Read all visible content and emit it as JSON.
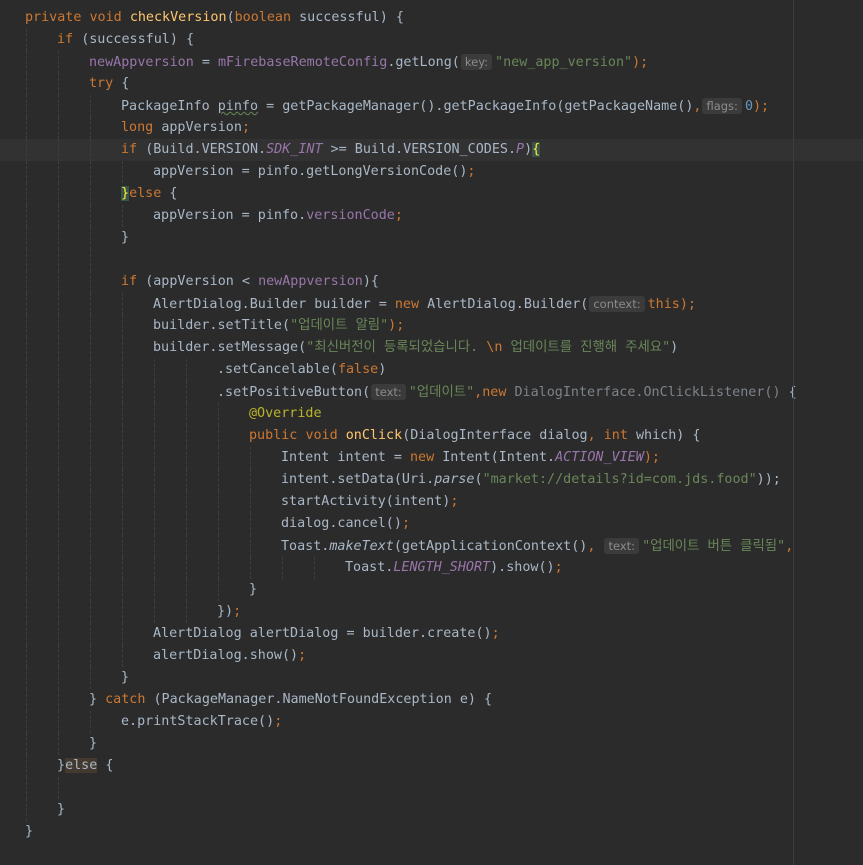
{
  "editor": {
    "lines": [
      {
        "indent": 0,
        "guides": [],
        "tokens": [
          {
            "t": "private ",
            "c": "keyword"
          },
          {
            "t": "void ",
            "c": "keyword"
          },
          {
            "t": "checkVersion",
            "c": "method"
          },
          {
            "t": "(",
            "c": "default"
          },
          {
            "t": "boolean ",
            "c": "keyword"
          },
          {
            "t": "successful) {",
            "c": "default"
          }
        ]
      },
      {
        "indent": 1,
        "guides": [
          0
        ],
        "tokens": [
          {
            "t": "if ",
            "c": "keyword"
          },
          {
            "t": "(successful) {",
            "c": "default"
          }
        ]
      },
      {
        "indent": 2,
        "guides": [
          0,
          1
        ],
        "tokens": [
          {
            "t": "newAppversion",
            "c": "field"
          },
          {
            "t": " = ",
            "c": "default"
          },
          {
            "t": "mFirebaseRemoteConfig",
            "c": "field"
          },
          {
            "t": ".getLong(",
            "c": "default"
          },
          {
            "t": "key:",
            "c": "hint"
          },
          {
            "t": "\"new_app_version\"",
            "c": "string"
          },
          {
            "t": ");",
            "c": "keyword"
          }
        ]
      },
      {
        "indent": 2,
        "guides": [
          0,
          1
        ],
        "tokens": [
          {
            "t": "try ",
            "c": "keyword"
          },
          {
            "t": "{",
            "c": "default"
          }
        ]
      },
      {
        "indent": 3,
        "guides": [
          0,
          1,
          2
        ],
        "tokens": [
          {
            "t": "PackageInfo ",
            "c": "default"
          },
          {
            "t": "pinfo",
            "c": "underline"
          },
          {
            "t": " = getPackageManager().getPackageInfo(getPackageName()",
            "c": "default"
          },
          {
            "t": ",",
            "c": "keyword"
          },
          {
            "t": "flags:",
            "c": "hint"
          },
          {
            "t": "0",
            "c": "number"
          },
          {
            "t": ");",
            "c": "keyword"
          }
        ]
      },
      {
        "indent": 3,
        "guides": [
          0,
          1,
          2
        ],
        "tokens": [
          {
            "t": "long ",
            "c": "keyword"
          },
          {
            "t": "appVersion",
            "c": "default"
          },
          {
            "t": ";",
            "c": "keyword"
          }
        ]
      },
      {
        "indent": 3,
        "guides": [
          0,
          1,
          2
        ],
        "current": true,
        "tokens": [
          {
            "t": "if ",
            "c": "keyword"
          },
          {
            "t": "(Build.VERSION.",
            "c": "default"
          },
          {
            "t": "SDK_INT",
            "c": "field-italic"
          },
          {
            "t": " >= Build.VERSION_CODES.",
            "c": "default"
          },
          {
            "t": "P",
            "c": "field-italic"
          },
          {
            "t": ")",
            "c": "default"
          },
          {
            "t": "{",
            "c": "brace-match"
          }
        ]
      },
      {
        "indent": 4,
        "guides": [
          0,
          1,
          2,
          3
        ],
        "tokens": [
          {
            "t": "appVersion = pinfo.getLongVersionCode()",
            "c": "default"
          },
          {
            "t": ";",
            "c": "keyword"
          }
        ]
      },
      {
        "indent": 3,
        "guides": [
          0,
          1,
          2
        ],
        "tokens": [
          {
            "t": "}",
            "c": "brace-match"
          },
          {
            "t": "else ",
            "c": "keyword"
          },
          {
            "t": "{",
            "c": "default"
          }
        ]
      },
      {
        "indent": 4,
        "guides": [
          0,
          1,
          2,
          3
        ],
        "tokens": [
          {
            "t": "appVersion = pinfo.",
            "c": "default"
          },
          {
            "t": "versionCode",
            "c": "field"
          },
          {
            "t": ";",
            "c": "keyword"
          }
        ]
      },
      {
        "indent": 3,
        "guides": [
          0,
          1,
          2
        ],
        "tokens": [
          {
            "t": "}",
            "c": "default"
          }
        ]
      },
      {
        "indent": 0,
        "guides": [
          0,
          1,
          2
        ],
        "tokens": []
      },
      {
        "indent": 3,
        "guides": [
          0,
          1,
          2
        ],
        "tokens": [
          {
            "t": "if ",
            "c": "keyword"
          },
          {
            "t": "(appVersion < ",
            "c": "default"
          },
          {
            "t": "newAppversion",
            "c": "field"
          },
          {
            "t": "){",
            "c": "default"
          }
        ]
      },
      {
        "indent": 4,
        "guides": [
          0,
          1,
          2,
          3
        ],
        "tokens": [
          {
            "t": "AlertDialog.Builder builder = ",
            "c": "default"
          },
          {
            "t": "new ",
            "c": "keyword"
          },
          {
            "t": "AlertDialog.Builder(",
            "c": "default"
          },
          {
            "t": "context:",
            "c": "hint"
          },
          {
            "t": "this",
            "c": "keyword"
          },
          {
            "t": ");",
            "c": "keyword"
          }
        ]
      },
      {
        "indent": 4,
        "guides": [
          0,
          1,
          2,
          3
        ],
        "tokens": [
          {
            "t": "builder.setTitle(",
            "c": "default"
          },
          {
            "t": "\"업데이트 알림\"",
            "c": "string"
          },
          {
            "t": ");",
            "c": "keyword"
          }
        ]
      },
      {
        "indent": 4,
        "guides": [
          0,
          1,
          2,
          3
        ],
        "tokens": [
          {
            "t": "builder.setMessage(",
            "c": "default"
          },
          {
            "t": "\"최신버전이 등록되었습니다. ",
            "c": "string"
          },
          {
            "t": "\\n",
            "c": "keyword"
          },
          {
            "t": " 업데이트를 진행해 주세요\"",
            "c": "string"
          },
          {
            "t": ")",
            "c": "default"
          }
        ]
      },
      {
        "indent": 6,
        "guides": [
          0,
          1,
          2,
          3,
          4,
          5
        ],
        "tokens": [
          {
            "t": ".setCancelable(",
            "c": "default"
          },
          {
            "t": "false",
            "c": "keyword"
          },
          {
            "t": ")",
            "c": "default"
          }
        ]
      },
      {
        "indent": 6,
        "guides": [
          0,
          1,
          2,
          3,
          4,
          5
        ],
        "tokens": [
          {
            "t": ".setPositiveButton(",
            "c": "default"
          },
          {
            "t": "text:",
            "c": "hint"
          },
          {
            "t": "\"업데이트\"",
            "c": "string"
          },
          {
            "t": ",",
            "c": "keyword"
          },
          {
            "t": "new ",
            "c": "keyword"
          },
          {
            "t": "DialogInterface.OnClickListener() ",
            "c": "muted"
          },
          {
            "t": "{",
            "c": "default"
          }
        ]
      },
      {
        "indent": 7,
        "guides": [
          0,
          1,
          2,
          3,
          4,
          5,
          6
        ],
        "tokens": [
          {
            "t": "@Override",
            "c": "annotation"
          }
        ]
      },
      {
        "indent": 7,
        "guides": [
          0,
          1,
          2,
          3,
          4,
          5,
          6
        ],
        "tokens": [
          {
            "t": "public ",
            "c": "keyword"
          },
          {
            "t": "void ",
            "c": "keyword"
          },
          {
            "t": "onClick",
            "c": "method"
          },
          {
            "t": "(DialogInterface dialog",
            "c": "default"
          },
          {
            "t": ", ",
            "c": "keyword"
          },
          {
            "t": "int ",
            "c": "keyword"
          },
          {
            "t": "which) {",
            "c": "default"
          }
        ]
      },
      {
        "indent": 8,
        "guides": [
          0,
          1,
          2,
          3,
          4,
          5,
          6,
          7
        ],
        "tokens": [
          {
            "t": "Intent intent = ",
            "c": "default"
          },
          {
            "t": "new ",
            "c": "keyword"
          },
          {
            "t": "Intent(Intent.",
            "c": "default"
          },
          {
            "t": "ACTION_VIEW",
            "c": "field-italic"
          },
          {
            "t": ");",
            "c": "keyword"
          }
        ]
      },
      {
        "indent": 8,
        "guides": [
          0,
          1,
          2,
          3,
          4,
          5,
          6,
          7
        ],
        "tokens": [
          {
            "t": "intent.setData(Uri.",
            "c": "default"
          },
          {
            "t": "parse",
            "c": "static-method"
          },
          {
            "t": "(",
            "c": "default"
          },
          {
            "t": "\"market://details?id=com.jds.food\"",
            "c": "string"
          },
          {
            "t": "));",
            "c": "default"
          }
        ]
      },
      {
        "indent": 8,
        "guides": [
          0,
          1,
          2,
          3,
          4,
          5,
          6,
          7
        ],
        "tokens": [
          {
            "t": "startActivity(intent)",
            "c": "default"
          },
          {
            "t": ";",
            "c": "keyword"
          }
        ]
      },
      {
        "indent": 8,
        "guides": [
          0,
          1,
          2,
          3,
          4,
          5,
          6,
          7
        ],
        "tokens": [
          {
            "t": "dialog.cancel()",
            "c": "default"
          },
          {
            "t": ";",
            "c": "keyword"
          }
        ]
      },
      {
        "indent": 8,
        "guides": [
          0,
          1,
          2,
          3,
          4,
          5,
          6,
          7
        ],
        "tokens": [
          {
            "t": "Toast.",
            "c": "default"
          },
          {
            "t": "makeText",
            "c": "static-method"
          },
          {
            "t": "(getApplicationContext()",
            "c": "default"
          },
          {
            "t": ", ",
            "c": "keyword"
          },
          {
            "t": "text:",
            "c": "hint"
          },
          {
            "t": "\"업데이트 버튼 클릭됨\"",
            "c": "string"
          },
          {
            "t": ",",
            "c": "keyword"
          }
        ]
      },
      {
        "indent": 10,
        "guides": [
          0,
          1,
          2,
          3,
          4,
          5,
          6,
          7,
          8,
          9
        ],
        "tokens": [
          {
            "t": "Toast.",
            "c": "default"
          },
          {
            "t": "LENGTH_SHORT",
            "c": "field-italic"
          },
          {
            "t": ").show()",
            "c": "default"
          },
          {
            "t": ";",
            "c": "keyword"
          }
        ]
      },
      {
        "indent": 7,
        "guides": [
          0,
          1,
          2,
          3,
          4,
          5,
          6
        ],
        "tokens": [
          {
            "t": "}",
            "c": "default"
          }
        ]
      },
      {
        "indent": 6,
        "guides": [
          0,
          1,
          2,
          3,
          4,
          5
        ],
        "tokens": [
          {
            "t": "})",
            "c": "default"
          },
          {
            "t": ";",
            "c": "keyword"
          }
        ]
      },
      {
        "indent": 4,
        "guides": [
          0,
          1,
          2,
          3
        ],
        "tokens": [
          {
            "t": "AlertDialog alertDialog = builder.create()",
            "c": "default"
          },
          {
            "t": ";",
            "c": "keyword"
          }
        ]
      },
      {
        "indent": 4,
        "guides": [
          0,
          1,
          2,
          3
        ],
        "tokens": [
          {
            "t": "alertDialog.show()",
            "c": "default"
          },
          {
            "t": ";",
            "c": "keyword"
          }
        ]
      },
      {
        "indent": 3,
        "guides": [
          0,
          1,
          2
        ],
        "tokens": [
          {
            "t": "}",
            "c": "default"
          }
        ]
      },
      {
        "indent": 2,
        "guides": [
          0,
          1
        ],
        "tokens": [
          {
            "t": "} ",
            "c": "default"
          },
          {
            "t": "catch ",
            "c": "keyword"
          },
          {
            "t": "(PackageManager.NameNotFoundException e) {",
            "c": "default"
          }
        ]
      },
      {
        "indent": 3,
        "guides": [
          0,
          1,
          2
        ],
        "tokens": [
          {
            "t": "e.printStackTrace()",
            "c": "default"
          },
          {
            "t": ";",
            "c": "keyword"
          }
        ]
      },
      {
        "indent": 2,
        "guides": [
          0,
          1
        ],
        "tokens": [
          {
            "t": "}",
            "c": "default"
          }
        ]
      },
      {
        "indent": 1,
        "guides": [
          0
        ],
        "tokens": [
          {
            "t": "}",
            "c": "default"
          },
          {
            "t": "else",
            "c": "match-kw"
          },
          {
            "t": " {",
            "c": "default"
          }
        ]
      },
      {
        "indent": 0,
        "guides": [
          0,
          1
        ],
        "tokens": []
      },
      {
        "indent": 1,
        "guides": [
          0
        ],
        "tokens": [
          {
            "t": "}",
            "c": "default"
          }
        ]
      },
      {
        "indent": 0,
        "guides": [],
        "tokens": [
          {
            "t": "}",
            "c": "default"
          }
        ]
      }
    ]
  }
}
